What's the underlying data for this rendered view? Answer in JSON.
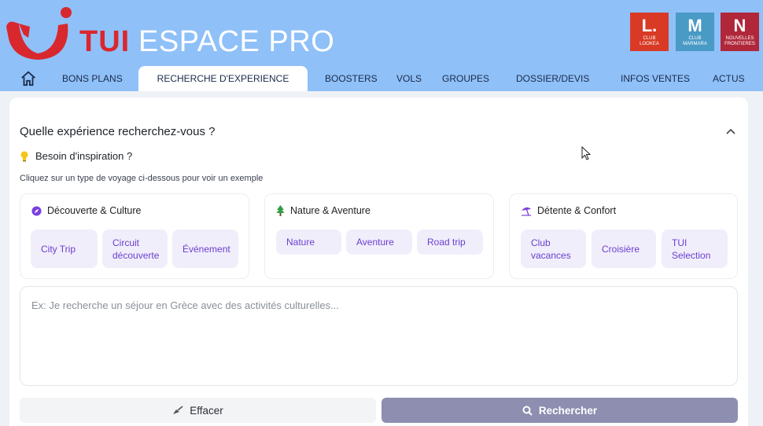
{
  "header": {
    "logo_brand": "TUI",
    "logo_product": "ESPACE PRO",
    "colors": {
      "header_bg": "#8fc0f8",
      "tui_red": "#d9272e"
    },
    "brands": [
      {
        "glyph": "L.",
        "line1": "CLUB",
        "line2": "LOOKEA",
        "color": "#d93a26"
      },
      {
        "glyph": "M",
        "line1": "CLUB",
        "line2": "MARMARA",
        "color": "#4a9ac6"
      },
      {
        "glyph": "N",
        "line1": "NOUVELLES",
        "line2": "FRONTIERES",
        "color": "#b0273a"
      }
    ]
  },
  "nav": {
    "home_icon": "home-icon",
    "items": [
      {
        "label": "BONS PLANS"
      },
      {
        "label": "RECHERCHE D'EXPERIENCE",
        "active": true
      },
      {
        "label": "BOOSTERS"
      },
      {
        "label": "VOLS"
      },
      {
        "label": "GROUPES"
      },
      {
        "label": "DOSSIER/DEVIS"
      },
      {
        "label": "INFOS VENTES"
      },
      {
        "label": "ACTUS"
      }
    ]
  },
  "search": {
    "title": "Quelle expérience recherchez-vous ?",
    "inspiration": "Besoin d'inspiration ?",
    "hint": "Cliquez sur un type de voyage ci-dessous pour voir un exemple",
    "categories": [
      {
        "icon": "compass-icon",
        "title": "Découverte & Culture",
        "chips": [
          "City Trip",
          "Circuit\ndécouverte",
          "Événement"
        ]
      },
      {
        "icon": "tree-icon",
        "title": "Nature & Aventure",
        "chips": [
          "Nature",
          "Aventure",
          "Road trip"
        ]
      },
      {
        "icon": "beach-umbrella-icon",
        "title": "Détente & Confort",
        "chips": [
          "Club\nvacances",
          "Croisière",
          "TUI\nSelection"
        ]
      }
    ],
    "placeholder": "Ex: Je recherche un séjour en Grèce avec des activités culturelles...",
    "clear_label": "Effacer",
    "search_label": "Rechercher",
    "colors": {
      "chip_bg": "#f1eefb",
      "chip_text": "#6a3fcf",
      "search_btn": "#8d8eb0"
    }
  }
}
